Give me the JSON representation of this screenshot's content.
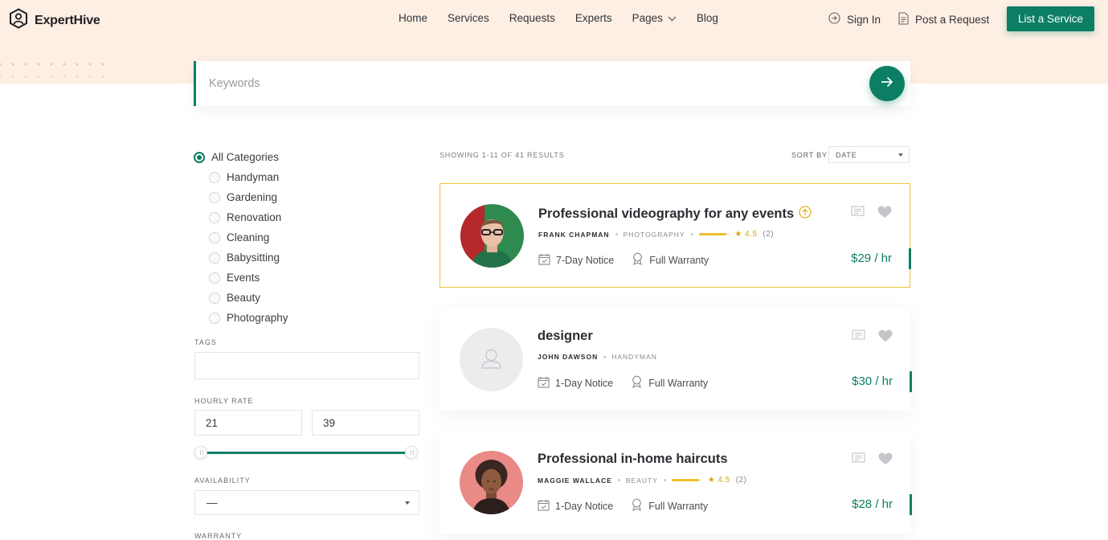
{
  "brand": {
    "name": "ExpertHive"
  },
  "nav": {
    "items": [
      "Home",
      "Services",
      "Requests",
      "Experts",
      "Pages",
      "Blog"
    ],
    "sign_in": "Sign In",
    "post_request": "Post a Request",
    "list_service": "List a Service"
  },
  "search": {
    "placeholder": "Keywords"
  },
  "sidebar": {
    "categories": [
      "All Categories",
      "Handyman",
      "Gardening",
      "Renovation",
      "Cleaning",
      "Babysitting",
      "Events",
      "Beauty",
      "Photography"
    ],
    "selected_category": "All Categories",
    "tags_label": "TAGS",
    "tags_value": "",
    "hourly_rate_label": "HOURLY RATE",
    "rate_min": "21",
    "rate_max": "39",
    "availability_label": "AVAILABILITY",
    "availability_value": "—",
    "warranty_label": "WARRANTY"
  },
  "results": {
    "showing": "SHOWING 1-11 OF 41 RESULTS",
    "sort_by_label": "SORT BY",
    "sort_value": "DATE"
  },
  "listings": [
    {
      "title": "Professional videography for any events",
      "author": "FRANK CHAPMAN",
      "category": "PHOTOGRAPHY",
      "rating": "4.5",
      "rating_count": "(2)",
      "rating_fraction": 0.9,
      "notice": "7-Day Notice",
      "warranty": "Full Warranty",
      "price": "$29 / hr",
      "featured": true
    },
    {
      "title": "designer",
      "author": "JOHN DAWSON",
      "category": "HANDYMAN",
      "notice": "1-Day Notice",
      "warranty": "Full Warranty",
      "price": "$30 / hr",
      "featured": false
    },
    {
      "title": "Professional in-home haircuts",
      "author": "MAGGIE WALLACE",
      "category": "BEAUTY",
      "rating": "4.5",
      "rating_count": "(2)",
      "rating_fraction": 0.9,
      "notice": "1-Day Notice",
      "warranty": "Full Warranty",
      "price": "$28 / hr",
      "featured": false
    }
  ],
  "colors": {
    "accent": "#0b7e63",
    "header_bg": "#fdefe3",
    "featured_border": "#ecc533",
    "rating": "#eec02a"
  }
}
